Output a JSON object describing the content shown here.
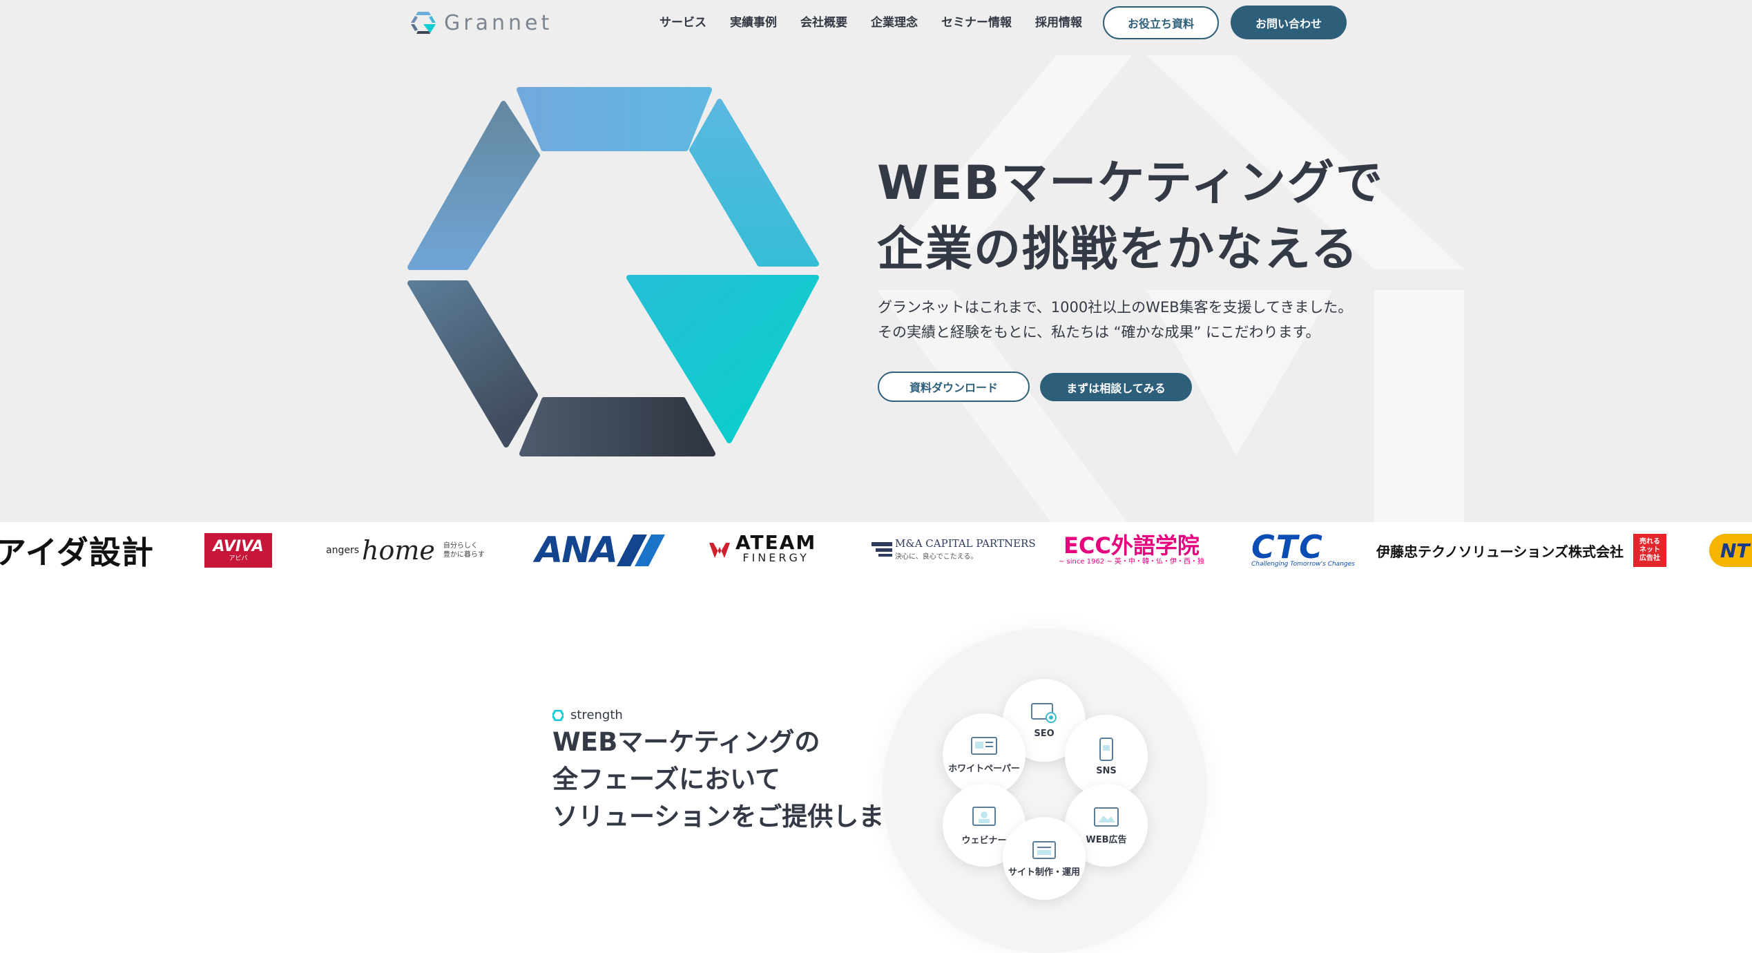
{
  "header": {
    "logo_text": "Grannet",
    "nav": [
      "サービス",
      "実績事例",
      "会社概要",
      "企業理念",
      "セミナー情報",
      "採用情報"
    ],
    "resources_button": "お役立ち資料",
    "contact_button": "お問い合わせ"
  },
  "hero": {
    "title_line1": "WEBマーケティングで",
    "title_line2": "企業の挑戦をかなえる",
    "desc_line1": "グランネットはこれまで、1000社以上のWEB集客を支援してきました。",
    "desc_line2": "その実績と経験をもとに、私たちは “確かな成果” にこだわります。",
    "download_button": "資料ダウンロード",
    "consult_button": "まずは相談してみる"
  },
  "clients": {
    "aida": "アイダ設計",
    "aviva": "AVIVA",
    "aviva_sub": "アビバ",
    "angers_small": "angers",
    "angers_home": "home",
    "angers_tag1": "自分らしく",
    "angers_tag2": "豊かに暮らす",
    "ana": "ANA",
    "ateam_main": "ATEAM",
    "ateam_sub": "FINERGY",
    "ma_main": "M&A CAPITAL PARTNERS",
    "ma_sub": "決心に、良心でこたえる。",
    "ecc_main": "ECC外語学院",
    "ecc_sub": "~ since 1962 ~ 英・中・韓・仏・伊・西・独",
    "ctc_main": "CTC",
    "ctc_sub": "Challenging Tomorrow's Changes",
    "itochu": "伊藤忠テクノソリューションズ株式会社",
    "ureru": "売れるネット広告社",
    "ntt": "NT"
  },
  "strength": {
    "eyebrow": "strength",
    "title_line1": "WEBマーケティングの",
    "title_line2": "全フェーズにおいて",
    "title_line3": "ソリューションをご提供します",
    "bubbles": [
      "SEO",
      "ホワイトペーパー",
      "SNS",
      "ウェビナー",
      "WEB広告",
      "サイト制作・運用"
    ]
  },
  "colors": {
    "accent": "#2e5f7a",
    "teal": "#11ccd0",
    "hero_bg": "#eeeeee",
    "text": "#333a45"
  }
}
